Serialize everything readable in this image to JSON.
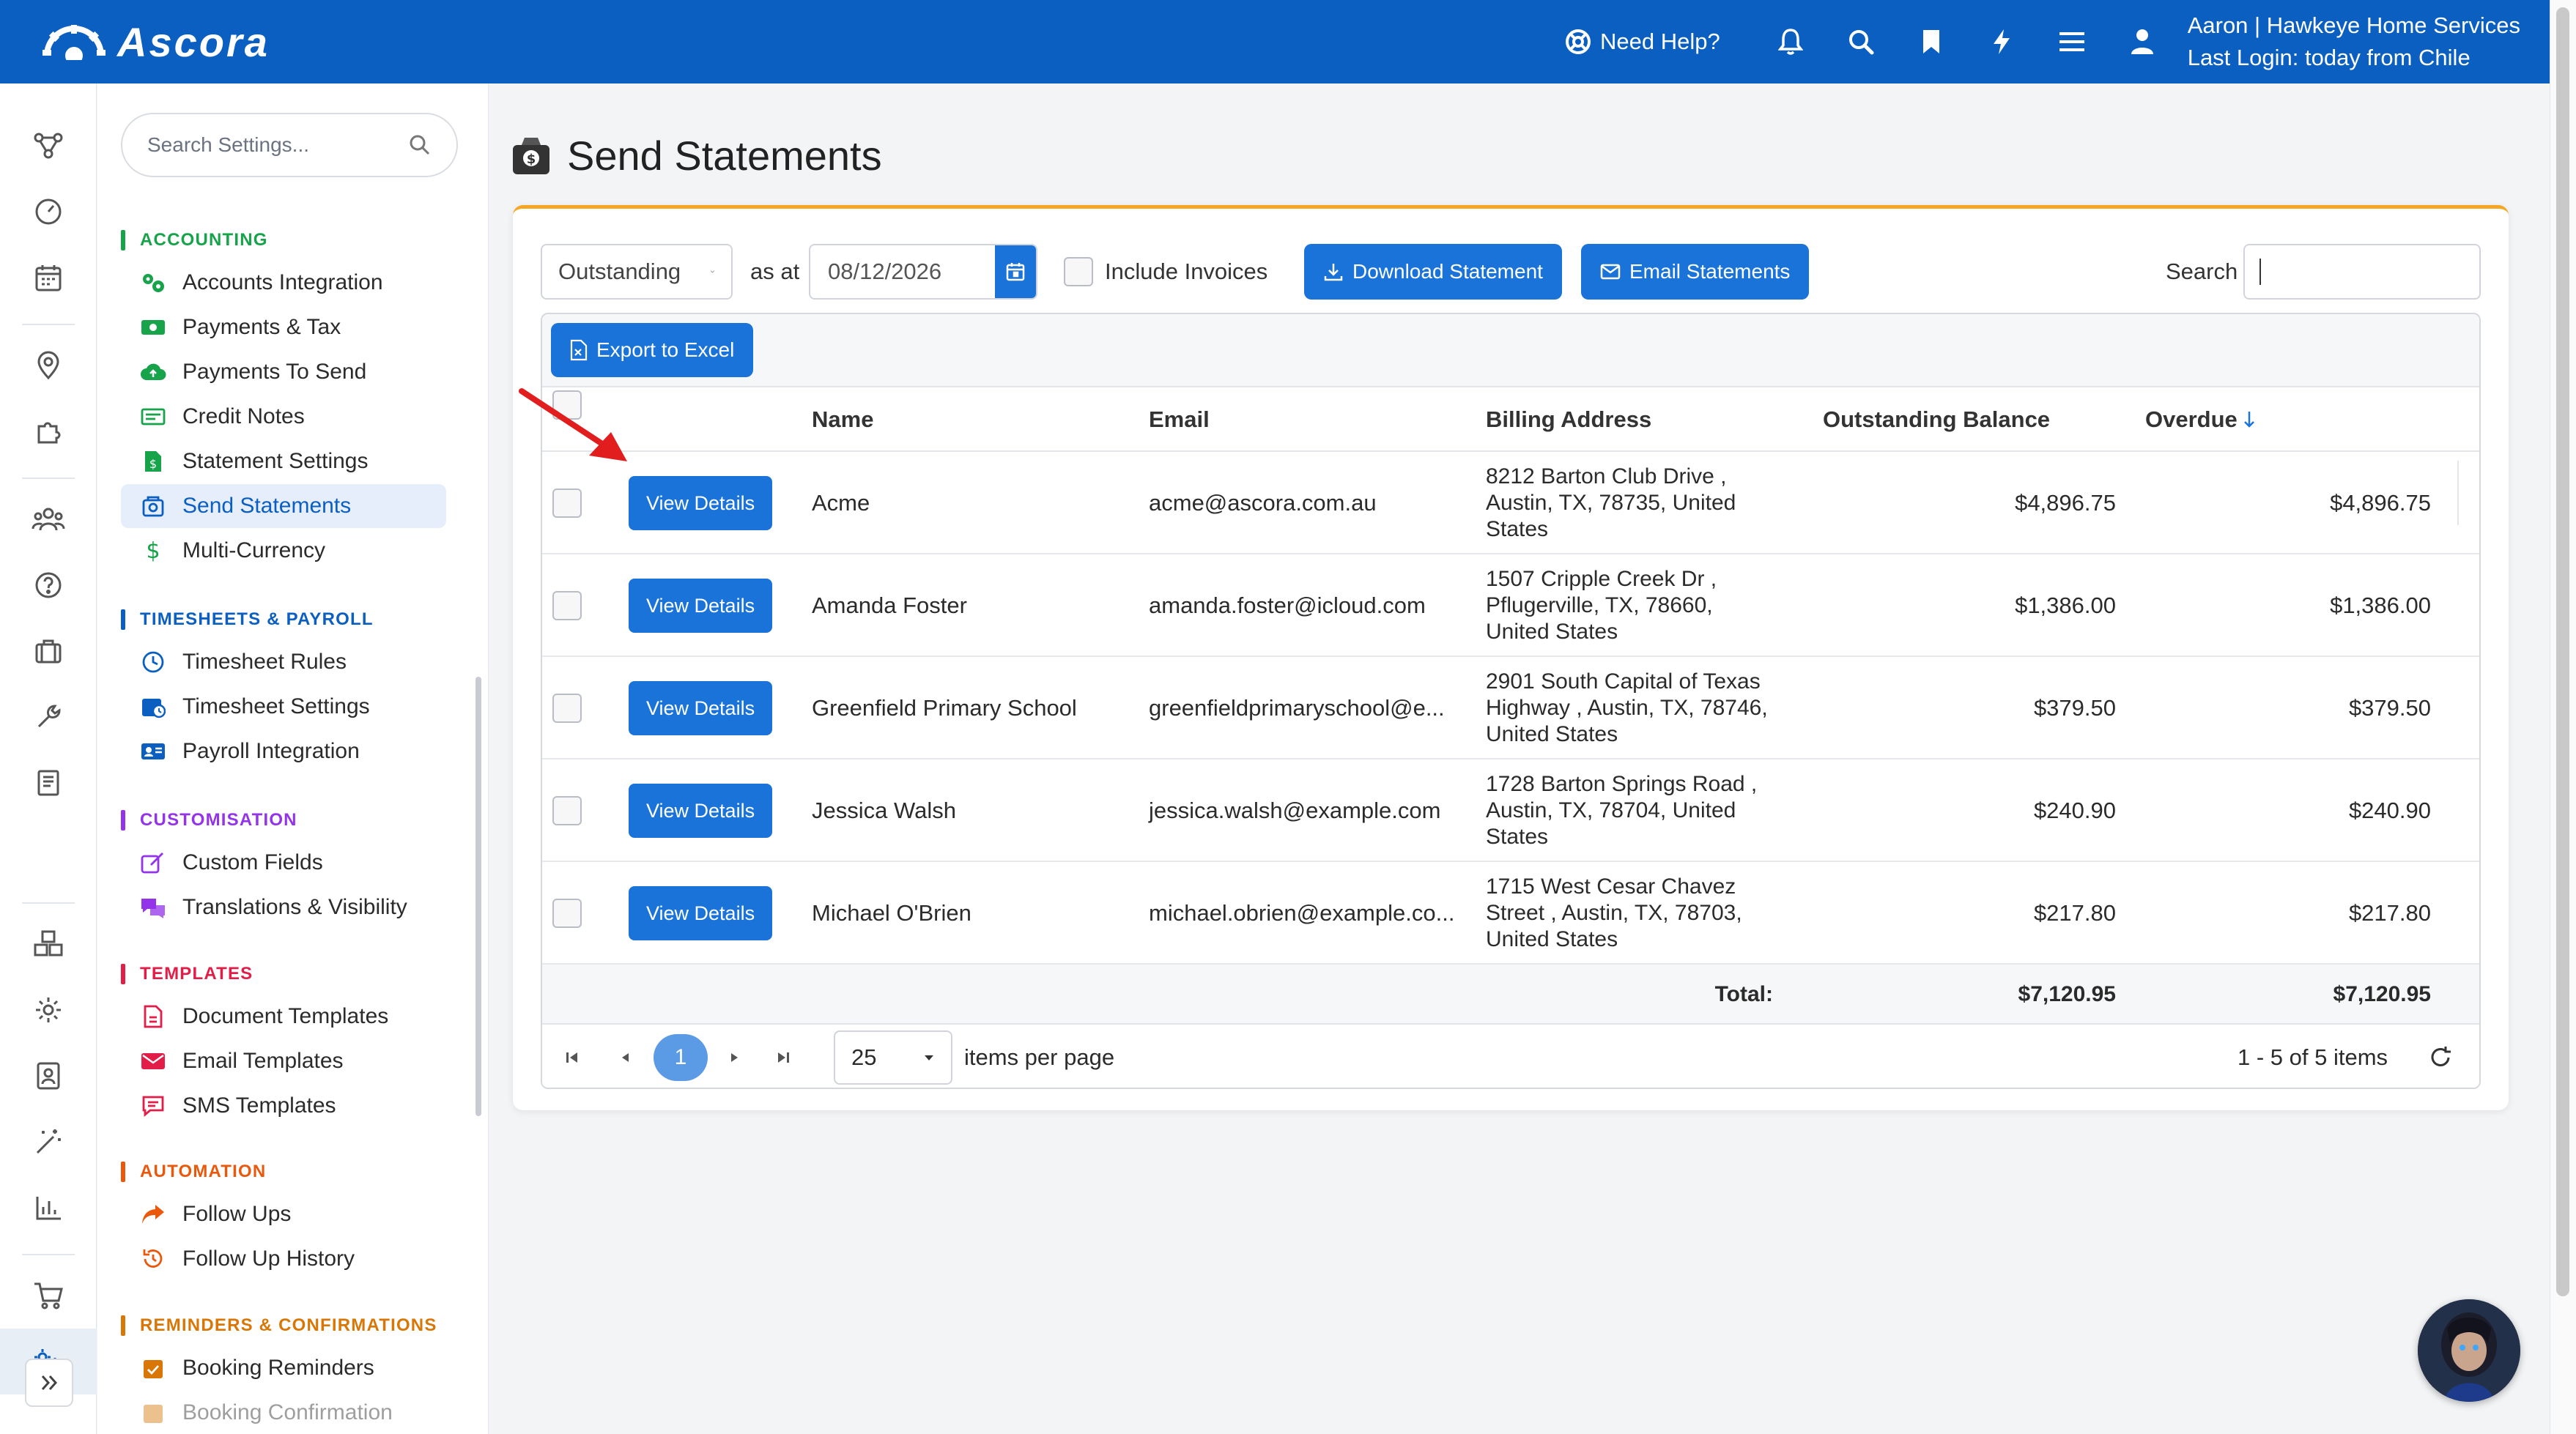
{
  "app": {
    "name": "Ascora"
  },
  "header": {
    "help_label": "Need Help?",
    "user_line1": "Aaron | Hawkeye Home Services",
    "user_line2": "Last Login: today from Chile"
  },
  "sidebar": {
    "search_placeholder": "Search Settings...",
    "sections": [
      {
        "title": "ACCOUNTING",
        "color": "#16a34a"
      },
      {
        "title": "TIMESHEETS & PAYROLL",
        "color": "#0a5fc0"
      },
      {
        "title": "CUSTOMISATION",
        "color": "#9333ea"
      },
      {
        "title": "TEMPLATES",
        "color": "#e11d48"
      },
      {
        "title": "AUTOMATION",
        "color": "#ea580c"
      },
      {
        "title": "REMINDERS & CONFIRMATIONS",
        "color": "#d97706"
      }
    ],
    "items": {
      "accounts_integration": "Accounts Integration",
      "payments_tax": "Payments & Tax",
      "payments_to_send": "Payments To Send",
      "credit_notes": "Credit Notes",
      "statement_settings": "Statement Settings",
      "send_statements": "Send Statements",
      "multi_currency": "Multi-Currency",
      "timesheet_rules": "Timesheet Rules",
      "timesheet_settings": "Timesheet Settings",
      "payroll_integration": "Payroll Integration",
      "custom_fields": "Custom Fields",
      "translations_visibility": "Translations & Visibility",
      "document_templates": "Document Templates",
      "email_templates": "Email Templates",
      "sms_templates": "SMS Templates",
      "follow_ups": "Follow Ups",
      "follow_up_history": "Follow Up History",
      "booking_reminders": "Booking Reminders",
      "booking_confirmation": "Booking Confirmation"
    }
  },
  "page": {
    "title": "Send Statements"
  },
  "toolbar": {
    "filter_value": "Outstanding",
    "as_at_label": "as at",
    "date_value": "08/12/2026",
    "include_invoices_label": "Include Invoices",
    "download_label": "Download Statement",
    "email_label": "Email Statements",
    "search_label": "Search"
  },
  "grid": {
    "export_label": "Export to Excel",
    "columns": {
      "name": "Name",
      "email": "Email",
      "billing": "Billing Address",
      "outstanding": "Outstanding Balance",
      "overdue": "Overdue"
    },
    "view_label": "View Details",
    "rows": [
      {
        "name": "Acme",
        "email": "acme@ascora.com.au",
        "addr1": "8212 Barton Club Drive ,",
        "addr2": "Austin, TX, 78735, United",
        "addr3": "States",
        "outstanding": "$4,896.75",
        "overdue": "$4,896.75"
      },
      {
        "name": "Amanda Foster",
        "email": "amanda.foster@icloud.com",
        "addr1": "1507 Cripple Creek Dr ,",
        "addr2": "Pflugerville, TX, 78660,",
        "addr3": "United States",
        "outstanding": "$1,386.00",
        "overdue": "$1,386.00"
      },
      {
        "name": "Greenfield Primary School",
        "email": "greenfieldprimaryschool@e...",
        "addr1": "2901 South Capital of Texas",
        "addr2": "Highway , Austin, TX, 78746,",
        "addr3": "United States",
        "outstanding": "$379.50",
        "overdue": "$379.50"
      },
      {
        "name": "Jessica Walsh",
        "email": "jessica.walsh@example.com",
        "addr1": "1728 Barton Springs Road ,",
        "addr2": "Austin, TX, 78704, United",
        "addr3": "States",
        "outstanding": "$240.90",
        "overdue": "$240.90"
      },
      {
        "name": "Michael O'Brien",
        "email": "michael.obrien@example.co...",
        "addr1": "1715 West Cesar Chavez",
        "addr2": "Street , Austin, TX, 78703,",
        "addr3": "United States",
        "outstanding": "$217.80",
        "overdue": "$217.80"
      }
    ],
    "total_label": "Total:",
    "total_outstanding": "$7,120.95",
    "total_overdue": "$7,120.95",
    "pager": {
      "current_page": "1",
      "page_size": "25",
      "items_per_page_label": "items per page",
      "range_label": "1 - 5 of 5 items"
    }
  },
  "icons": {
    "accent": "#0a5fc0",
    "button": "#1a73d9",
    "card_accent": "#f5a623",
    "annotation_arrow": "#e11d1d"
  }
}
